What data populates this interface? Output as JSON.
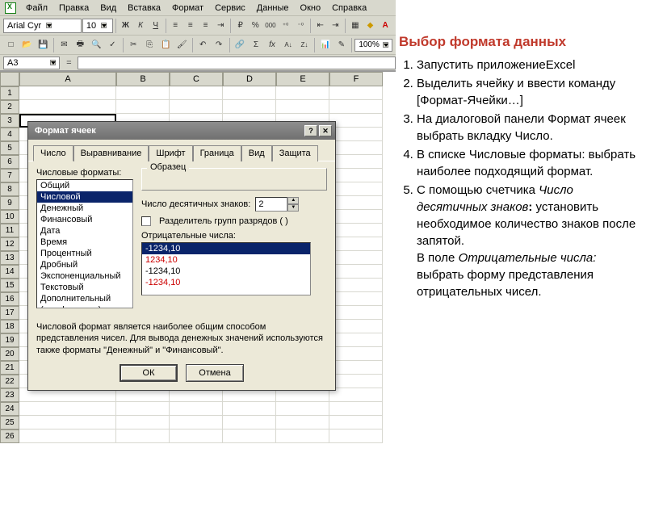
{
  "menubar": {
    "items": [
      "Файл",
      "Правка",
      "Вид",
      "Вставка",
      "Формат",
      "Сервис",
      "Данные",
      "Окно",
      "Справка"
    ]
  },
  "font_toolbar": {
    "font_name": "Arial Cyr",
    "font_size": "10",
    "buttons": {
      "bold": "Ж",
      "italic": "К",
      "underline": "Ч",
      "align_left": "≡",
      "align_center": "≡",
      "align_right": "≡",
      "merge": "⇥",
      "currency": "₽",
      "percent": "%",
      "comma": "000",
      "inc_dec": "⁺⁰",
      "dec_dec": "⁻⁰",
      "indent_dec": "⇤",
      "indent_inc": "⇥",
      "border": "▦",
      "fill": "◆",
      "font_color": "A"
    }
  },
  "std_toolbar": {
    "buttons": {
      "new": "□",
      "open": "📂",
      "save": "💾",
      "mail": "✉",
      "print": "🖶",
      "preview": "🔍",
      "spell": "✓",
      "cut": "✂",
      "copy": "⎘",
      "paste": "📋",
      "fmtpaint": "🖌",
      "undo": "↶",
      "redo": "↷",
      "link": "🔗",
      "sum": "Σ",
      "fx": "fx",
      "sort_asc": "A↓",
      "sort_desc": "Z↓",
      "chart": "📊",
      "drawing": "✎",
      "zoom": "100%"
    }
  },
  "name_box": {
    "value": "A3",
    "fx": "="
  },
  "columns": [
    "A",
    "B",
    "C",
    "D",
    "E",
    "F"
  ],
  "rows_count": 26,
  "selected_cell": "A3",
  "dialog": {
    "title": "Формат ячеек",
    "tabs": [
      "Число",
      "Выравнивание",
      "Шрифт",
      "Граница",
      "Вид",
      "Защита"
    ],
    "active_tab": 0,
    "formats_label": "Числовые форматы:",
    "formats": [
      "Общий",
      "Числовой",
      "Денежный",
      "Финансовый",
      "Дата",
      "Время",
      "Процентный",
      "Дробный",
      "Экспоненциальный",
      "Текстовый",
      "Дополнительный",
      "(все форматы)"
    ],
    "formats_selected": 1,
    "sample_label": "Образец",
    "decimals_label": "Число десятичных знаков:",
    "decimals_value": "2",
    "thousands_label": "Разделитель групп разрядов ( )",
    "negatives_label": "Отрицательные числа:",
    "negatives": [
      {
        "text": "-1234,10",
        "red": false,
        "sel": true
      },
      {
        "text": "1234,10",
        "red": true,
        "sel": false
      },
      {
        "text": "-1234,10",
        "red": false,
        "sel": false
      },
      {
        "text": "-1234,10",
        "red": true,
        "sel": false
      }
    ],
    "description": "Числовой формат является наиболее общим способом представления чисел. Для вывода денежных значений используются также форматы \"Денежный\" и \"Финансовый\".",
    "ok": "ОК",
    "cancel": "Отмена"
  },
  "instructions": {
    "title": "Выбор формата данных",
    "items": [
      "Запустить приложениеExcel",
      "Выделить ячейку и ввести команду [Формат-Ячейки…]",
      "На диалоговой панели Формат ячеек выбрать вкладку Число.",
      "В списке Числовые форматы: выбрать наиболее подходящий формат.",
      "С помощью счетчика <em>Число десятичных знаков</em><strong>:</strong> установить необходимое количество знаков после запятой.<br> В поле <em>Отрицательные числа:</em> выбрать форму представления отрицательных чисел."
    ]
  }
}
